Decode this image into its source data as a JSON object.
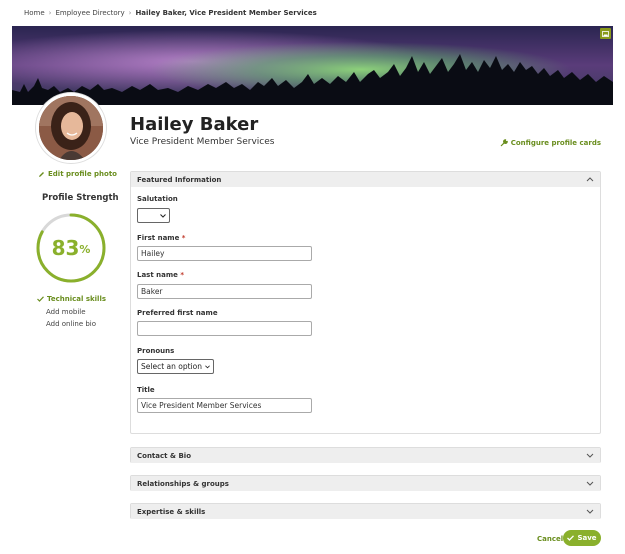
{
  "breadcrumb": {
    "items": [
      "Home",
      "Employee Directory"
    ],
    "current": "Hailey Baker, Vice President Member Services"
  },
  "profile": {
    "name": "Hailey Baker",
    "title": "Vice President Member Services",
    "edit_photo_label": "Edit profile photo",
    "configure_label": "Configure profile cards"
  },
  "strength": {
    "label": "Profile Strength",
    "value": 83,
    "value_text": "83",
    "unit": "%",
    "completed": [
      "Technical skills"
    ],
    "suggestions": [
      "Add mobile",
      "Add online bio"
    ]
  },
  "featured": {
    "header": "Featured Information",
    "fields": {
      "salutation_label": "Salutation",
      "salutation_value": "",
      "first_name_label": "First name",
      "first_name_value": "Hailey",
      "last_name_label": "Last name",
      "last_name_value": "Baker",
      "preferred_label": "Preferred first name",
      "preferred_value": "",
      "pronouns_label": "Pronouns",
      "pronouns_value": "Select an option",
      "title_label": "Title",
      "title_value": "Vice President Member Services",
      "required_mark": "*"
    }
  },
  "sections": {
    "contact": "Contact & Bio",
    "relationships": "Relationships & groups",
    "expertise": "Expertise & skills"
  },
  "actions": {
    "cancel": "Cancel",
    "save": "Save"
  },
  "colors": {
    "accent": "#8ab02c",
    "link": "#6a8e1f"
  }
}
